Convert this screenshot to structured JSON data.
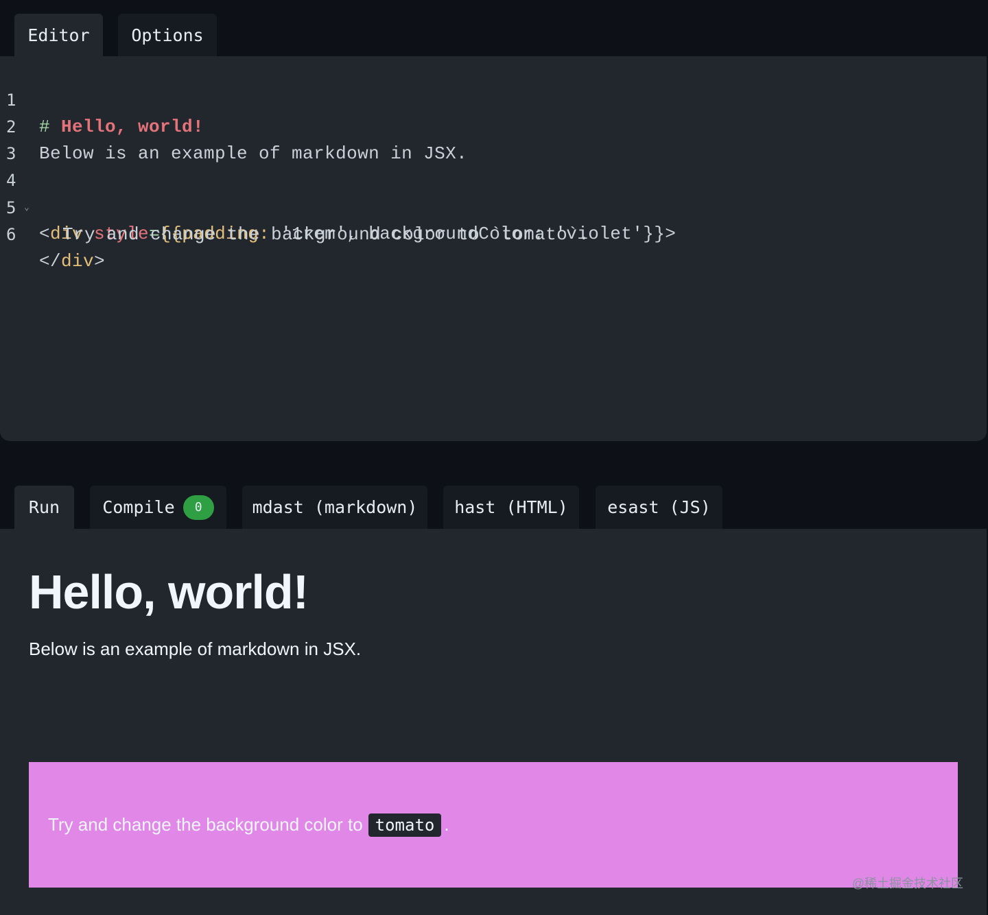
{
  "editor_tabs": [
    {
      "label": "Editor",
      "active": true
    },
    {
      "label": "Options",
      "active": false
    }
  ],
  "code_lines": [
    {
      "number": "1"
    },
    {
      "number": "2"
    },
    {
      "number": "3"
    },
    {
      "number": "4"
    },
    {
      "number": "5"
    },
    {
      "number": "6"
    }
  ],
  "code": {
    "l1_hash": "#",
    "l1_heading": "Hello, world!",
    "l2_text": "Below is an example of markdown in JSX.",
    "l4_open": "<",
    "l4_tag": "div",
    "l4_attr": "style",
    "l4_eq": "=",
    "l4_brace": "{{",
    "l4_key1": "padding:",
    "l4_val1": "'1rem',",
    "l4_key2": "backgroundColor:",
    "l4_val2": "'violet'",
    "l4_close_brace": "}}",
    "l4_close": ">",
    "l5_text": "Try and change the background color to `tomato`.",
    "l6_open": "</",
    "l6_tag": "div",
    "l6_close": ">"
  },
  "output_tabs": [
    {
      "label": "Run",
      "active": true
    },
    {
      "label": "Compile",
      "badge": "0",
      "active": false
    },
    {
      "label": "mdast (markdown)",
      "active": false
    },
    {
      "label": "hast (HTML)",
      "active": false
    },
    {
      "label": "esast (JS)",
      "active": false
    }
  ],
  "preview": {
    "heading": "Hello, world!",
    "paragraph": "Below is an example of markdown in JSX.",
    "box_text": "Try and change the background color to",
    "box_code": "tomato",
    "box_suffix": ".",
    "box_color": "#e087e8"
  },
  "watermark": "@稀土掘金技术社区",
  "colors": {
    "page_bg": "#0d1117",
    "panel_bg": "#22262d",
    "badge_bg": "#2ea043"
  }
}
